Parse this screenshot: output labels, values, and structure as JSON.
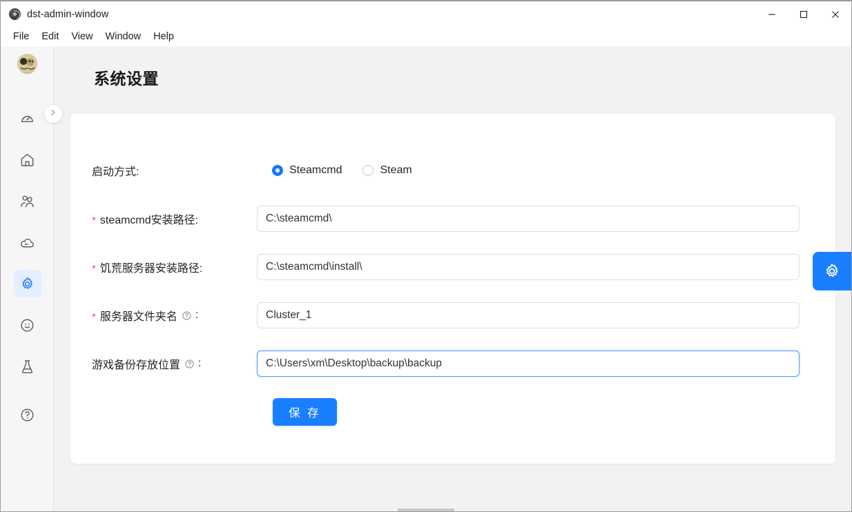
{
  "window": {
    "title": "dst-admin-window",
    "logo_icon": "atom-logo-icon",
    "controls": {
      "minimize": "minimize-icon",
      "maximize": "maximize-icon",
      "close": "close-icon"
    }
  },
  "menubar": {
    "items": [
      {
        "label": "File"
      },
      {
        "label": "Edit"
      },
      {
        "label": "View"
      },
      {
        "label": "Window"
      },
      {
        "label": "Help"
      }
    ]
  },
  "sidebar": {
    "avatar_name": "user-avatar",
    "expand_icon": "chevron-right-icon",
    "items": [
      {
        "name": "sidebar-item-dashboard",
        "icon": "dashboard-gauge-icon",
        "active": false
      },
      {
        "name": "sidebar-item-home",
        "icon": "home-icon",
        "active": false
      },
      {
        "name": "sidebar-item-players",
        "icon": "users-icon",
        "active": false
      },
      {
        "name": "sidebar-item-cloud",
        "icon": "cloud-icon",
        "active": false
      },
      {
        "name": "sidebar-item-settings",
        "icon": "gear-icon",
        "active": true
      },
      {
        "name": "sidebar-item-mood",
        "icon": "smiley-icon",
        "active": false
      },
      {
        "name": "sidebar-item-lab",
        "icon": "flask-icon",
        "active": false
      },
      {
        "name": "sidebar-item-help",
        "icon": "question-circle-icon",
        "active": false
      }
    ]
  },
  "page": {
    "title": "系统设置"
  },
  "form": {
    "startup_mode": {
      "label": "启动方式:",
      "options": [
        {
          "label": "Steamcmd",
          "checked": true
        },
        {
          "label": "Steam",
          "checked": false
        }
      ]
    },
    "fields": [
      {
        "name": "steamcmd-install-path",
        "required_mark": "*",
        "label": "steamcmd安装路径:",
        "has_help": false,
        "value": "C:\\steamcmd\\",
        "placeholder": "",
        "focused": false
      },
      {
        "name": "dst-server-install-path",
        "required_mark": "*",
        "label": "饥荒服务器安装路径:",
        "has_help": false,
        "value": "C:\\steamcmd\\install\\",
        "placeholder": "",
        "focused": false
      },
      {
        "name": "server-folder-name",
        "required_mark": "*",
        "label": "服务器文件夹名",
        "label_suffix": ":",
        "has_help": true,
        "help_icon": "question-circle-icon",
        "value": "Cluster_1",
        "placeholder": "",
        "focused": false
      },
      {
        "name": "game-backup-location",
        "required_mark": "",
        "label": "游戏备份存放位置",
        "label_suffix": ":",
        "has_help": true,
        "help_icon": "question-circle-icon",
        "value": "C:\\Users\\xm\\Desktop\\backup\\backup",
        "placeholder": "",
        "focused": true
      }
    ],
    "save_label": "保 存"
  },
  "floating": {
    "gear_icon": "gear-icon"
  },
  "colors": {
    "accent": "#1a7fff",
    "accent_radio": "#1677ff",
    "required_red": "#f05252",
    "sidebar_bg": "#f6f6f7",
    "page_bg": "#f2f2f3",
    "card_bg": "#ffffff",
    "text": "#22252a",
    "icon_muted": "#5c6066",
    "active_nav_bg": "#e3efff",
    "input_border": "#dcdfe4",
    "input_border_focus": "#4c9bf5"
  }
}
